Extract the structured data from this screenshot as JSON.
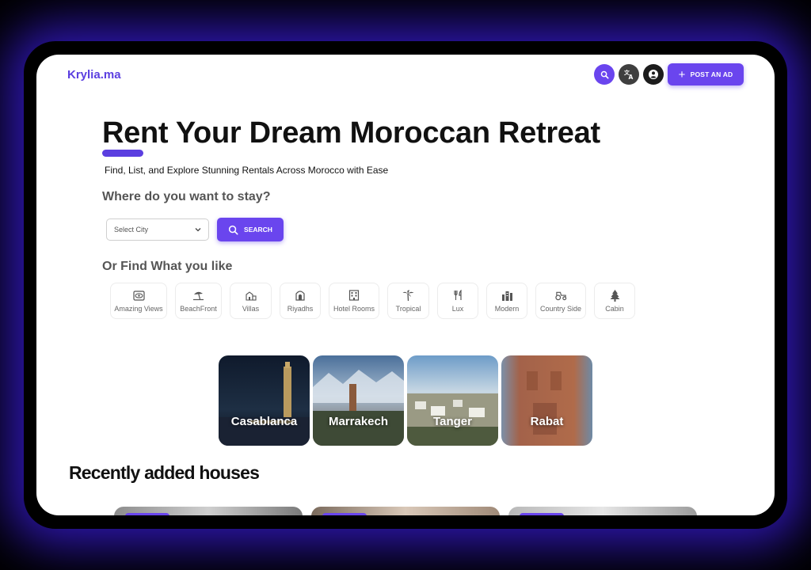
{
  "header": {
    "logo": "Krylia.ma",
    "post_ad_label": "POST AN AD"
  },
  "hero": {
    "title": "Rent Your Dream Moroccan Retreat",
    "subtitle": "Find, List, and Explore Stunning Rentals Across Morocco with Ease"
  },
  "search": {
    "heading": "Where do you want to stay?",
    "city_placeholder": "Select City",
    "button_label": "SEARCH"
  },
  "categories": {
    "heading": "Or Find What you like",
    "items": [
      {
        "label": "Amazing Views",
        "icon": "eye-icon"
      },
      {
        "label": "BeachFront",
        "icon": "beach-umbrella-icon"
      },
      {
        "label": "Villas",
        "icon": "villa-icon"
      },
      {
        "label": "Riyadhs",
        "icon": "riyadh-door-icon"
      },
      {
        "label": "Hotel Rooms",
        "icon": "hotel-icon"
      },
      {
        "label": "Tropical",
        "icon": "palm-tree-icon"
      },
      {
        "label": "Lux",
        "icon": "dining-icon"
      },
      {
        "label": "Modern",
        "icon": "buildings-icon"
      },
      {
        "label": "Country Side",
        "icon": "tractor-icon"
      },
      {
        "label": "Cabin",
        "icon": "pine-tree-icon"
      }
    ]
  },
  "cities": [
    {
      "name": "Casablanca"
    },
    {
      "name": "Marrakech"
    },
    {
      "name": "Tanger"
    },
    {
      "name": "Rabat"
    }
  ],
  "recent": {
    "heading": "Recently added houses"
  },
  "colors": {
    "accent": "#6a45ee",
    "logo": "#5b3fe0",
    "outer_glow": "#3c1ee6"
  }
}
